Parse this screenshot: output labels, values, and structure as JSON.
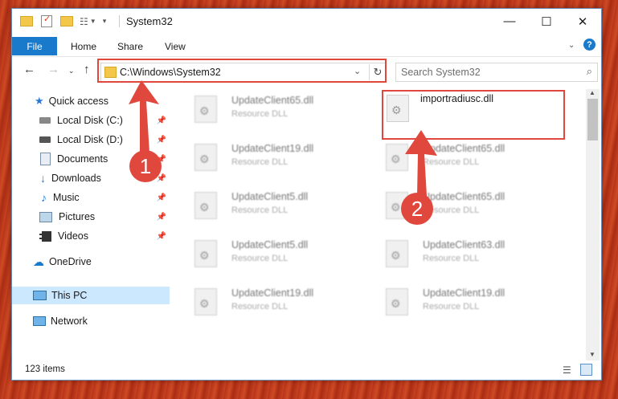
{
  "window": {
    "title": "System32"
  },
  "ribbon": {
    "tabs": [
      "File",
      "Home",
      "Share",
      "View"
    ]
  },
  "address": {
    "path": "C:\\Windows\\System32",
    "search_placeholder": "Search System32"
  },
  "sidebar": {
    "items": [
      {
        "label": "Quick access"
      },
      {
        "label": "Local Disk (C:)"
      },
      {
        "label": "Local Disk (D:)"
      },
      {
        "label": "Documents"
      },
      {
        "label": "Downloads"
      },
      {
        "label": "Music"
      },
      {
        "label": "Pictures"
      },
      {
        "label": "Videos"
      },
      {
        "label": "OneDrive"
      },
      {
        "label": "This PC"
      },
      {
        "label": "Network"
      }
    ]
  },
  "files": {
    "col1": [
      {
        "name": "UpdateClient65.dll",
        "type": "Resource DLL"
      },
      {
        "name": "UpdateClient19.dll",
        "type": "Resource DLL"
      },
      {
        "name": "UpdateClient5.dll",
        "type": "Resource DLL"
      },
      {
        "name": "UpdateClient5.dll",
        "type": "Resource DLL"
      },
      {
        "name": "UpdateClient19.dll",
        "type": "Resource DLL"
      }
    ],
    "col2": [
      {
        "name": "UpdateClient65.dll",
        "type": "Resource DLL"
      },
      {
        "name": "UpdateClient65.dll",
        "type": "Resource DLL"
      },
      {
        "name": "UpdateClient63.dll",
        "type": "Resource DLL"
      },
      {
        "name": "UpdateClient19.dll",
        "type": "Resource DLL"
      }
    ],
    "highlighted": {
      "name": "importradiusc.dll"
    }
  },
  "status": {
    "count": "123 items"
  },
  "annotations": {
    "step1": "1",
    "step2": "2"
  },
  "colors": {
    "accent": "#1979ca",
    "highlight": "#e0483e",
    "selected": "#cce8ff"
  }
}
